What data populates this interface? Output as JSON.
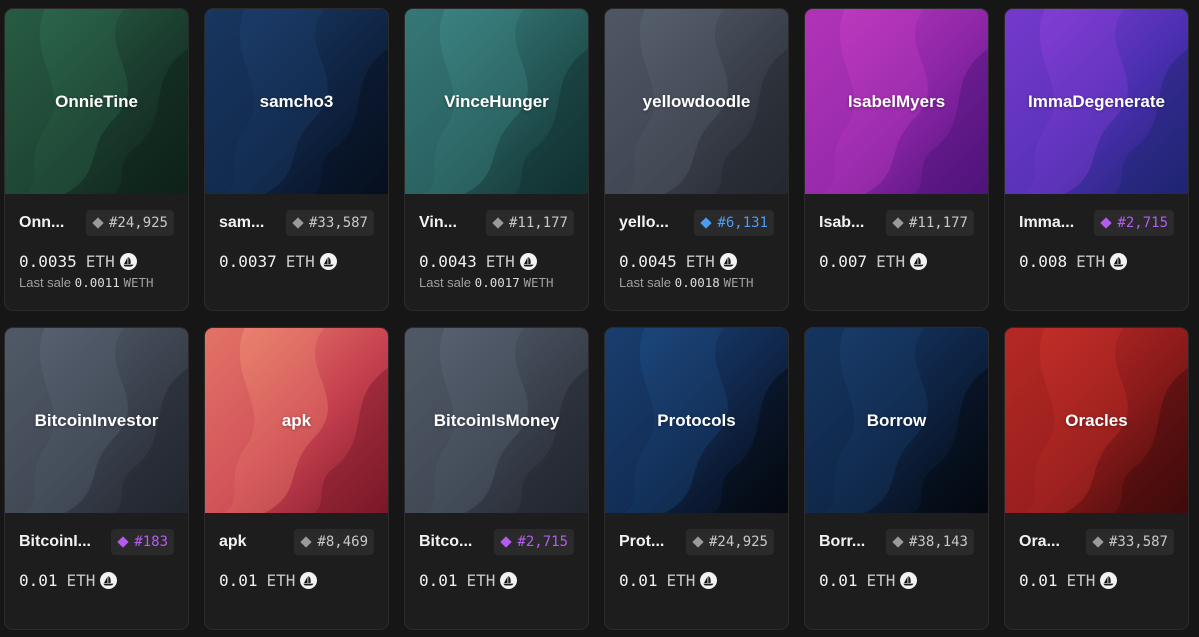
{
  "cards": [
    {
      "name": "OnnieTine",
      "short": "Onn...",
      "rank": "#24,925",
      "tier": "gray",
      "price": "0.0035",
      "unit": "ETH",
      "last_label": "Last sale",
      "last_value": "0.0011",
      "last_unit": "WETH",
      "colors": [
        "#2e6a4c",
        "#1a3b2d",
        "#0e2219"
      ]
    },
    {
      "name": "samcho3",
      "short": "sam...",
      "rank": "#33,587",
      "tier": "gray",
      "price": "0.0037",
      "unit": "ETH",
      "last_label": "",
      "last_value": "",
      "last_unit": "",
      "colors": [
        "#1d3f6c",
        "#0f2444",
        "#070f1f"
      ]
    },
    {
      "name": "VinceHunger",
      "short": "Vin...",
      "rank": "#11,177",
      "tier": "gray",
      "price": "0.0043",
      "unit": "ETH",
      "last_label": "Last sale",
      "last_value": "0.0017",
      "last_unit": "WETH",
      "colors": [
        "#3e8887",
        "#245756",
        "#123131"
      ]
    },
    {
      "name": "yellowdoodle",
      "short": "yello...",
      "rank": "#6,131",
      "tier": "blue",
      "price": "0.0045",
      "unit": "ETH",
      "last_label": "Last sale",
      "last_value": "0.0018",
      "last_unit": "WETH",
      "colors": [
        "#5a6270",
        "#3a404b",
        "#24282f"
      ]
    },
    {
      "name": "IsabelMyers",
      "short": "Isab...",
      "rank": "#11,177",
      "tier": "gray",
      "price": "0.007",
      "unit": "ETH",
      "last_label": "",
      "last_value": "",
      "last_unit": "",
      "colors": [
        "#c33bc0",
        "#8a25a6",
        "#4e137a"
      ]
    },
    {
      "name": "ImmaDegenerate",
      "short": "Imma...",
      "rank": "#2,715",
      "tier": "purple",
      "price": "0.008",
      "unit": "ETH",
      "last_label": "",
      "last_value": "",
      "last_unit": "",
      "colors": [
        "#8a3fd8",
        "#4a2fb0",
        "#1e2570"
      ]
    },
    {
      "name": "BitcoinInvestor",
      "short": "BitcoinI...",
      "rank": "#183",
      "tier": "purple",
      "price": "0.01",
      "unit": "ETH",
      "last_label": "",
      "last_value": "",
      "last_unit": "",
      "colors": [
        "#5a6473",
        "#3a414d",
        "#22262e"
      ]
    },
    {
      "name": "apk",
      "short": "apk",
      "rank": "#8,469",
      "tier": "gray",
      "price": "0.01",
      "unit": "ETH",
      "last_label": "",
      "last_value": "",
      "last_unit": "",
      "colors": [
        "#ef8a72",
        "#c6404f",
        "#7a1828"
      ]
    },
    {
      "name": "BitcoinIsMoney",
      "short": "Bitco...",
      "rank": "#2,715",
      "tier": "purple",
      "price": "0.01",
      "unit": "ETH",
      "last_label": "",
      "last_value": "",
      "last_unit": "",
      "colors": [
        "#5a6473",
        "#3a414d",
        "#22262e"
      ]
    },
    {
      "name": "Protocols",
      "short": "Prot...",
      "rank": "#24,925",
      "tier": "gray",
      "price": "0.01",
      "unit": "ETH",
      "last_label": "",
      "last_value": "",
      "last_unit": "",
      "colors": [
        "#1e4a80",
        "#0f2548",
        "#05080f"
      ]
    },
    {
      "name": "Borrow",
      "short": "Borr...",
      "rank": "#38,143",
      "tier": "gray",
      "price": "0.01",
      "unit": "ETH",
      "last_label": "",
      "last_value": "",
      "last_unit": "",
      "colors": [
        "#1a3f6e",
        "#0d2140",
        "#05080f"
      ]
    },
    {
      "name": "Oracles",
      "short": "Ora...",
      "rank": "#33,587",
      "tier": "gray",
      "price": "0.01",
      "unit": "ETH",
      "last_label": "",
      "last_value": "",
      "last_unit": "",
      "colors": [
        "#c8302a",
        "#8a1a1a",
        "#3e0a0a"
      ]
    }
  ],
  "icons": {
    "rarity": "diamond-icon",
    "currency": "opensea-icon"
  },
  "colors": {
    "rank_gray": "#9a9a9a",
    "rank_blue": "#4c9cf2",
    "rank_purple": "#b45cf0",
    "card_bg": "#1d1d1d",
    "page_bg": "#161616"
  }
}
